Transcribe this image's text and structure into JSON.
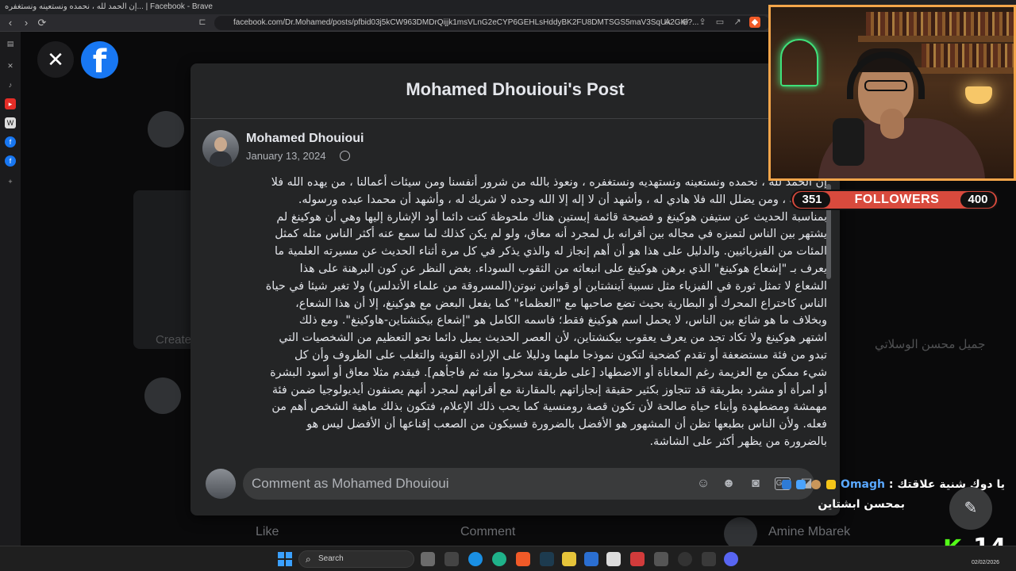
{
  "window": {
    "title": "إن الحمد لله ، نحمده ونستعينه ونستغفره... | Facebook - Brave",
    "url": "facebook.com/Dr.Mohamed/posts/pfbid03j5kCW963DMDrQijjk1msVLnG2eCYP6GEHLsHddyBK2FU8DMTSGS5maV3SqUx2GKl?..."
  },
  "modal": {
    "title": "Mohamed Dhouioui's Post",
    "author": "Mohamed Dhouioui",
    "date": "January 13, 2024",
    "body_lines": [
      "إن الحمد لله ، نحمده ونستعينه ونستهديه ونستغفره ، ونعوذ بالله من شرور أنفسنا ومن سيئات أعمالنا ، من يهده الله فلا",
      "مضل له ، ومن يضلل الله فلا هادي له ، وأشهد أن لا إله إلا الله وحده لا شريك له ، وأشهد أن محمدا عبده ورسوله.",
      "بمناسبة الحديث عن ستيفن هوكينغ و فضيحة قائمة إبستين هناك ملحوظة كنت دائما أود الإشارة إليها وهي أن هوكينغ لم",
      "يشتهر بين الناس لتميزه في مجاله بين أقرانه بل لمجرد أنه معاق، ولو لم يكن كذلك لما سمع عنه أكثر الناس مثله كمثل",
      "المئات من الفيزيائيين. والدليل على هذا هو أن أهم إنجاز له والذي يذكر في كل مرة أثناء الحديث عن مسيرته العلمية ما",
      "يعرف بـ \"إشعاع هوكينغ\" الذي برهن هوكينغ على انبعاثه من الثقوب السوداء. بغض النظر عن كون البرهنة على هذا",
      "الشعاع لا تمثل ثورة في الفيزياء مثل نسبية آينشتاين أو قوانين نيوتن(المسروقة من علماء الأندلس) ولا تغير شيئا في حياة",
      "الناس كاختراع المحرك أو البطارية بحيث تضع صاحبها مع \"العظماء\" كما يفعل البعض مع هوكينغ، إلا أن هذا الشعاع،",
      "وبخلاف ما هو شائع بين الناس، لا يحمل اسم هوكينغ فقط؛ فاسمه الكامل هو \"إشعاع بيكنشتاين-هاوكينغ\". ومع ذلك",
      "اشتهر هوكينغ ولا تكاد تجد من يعرف يعقوب بيكنشتاين، لأن العصر الحديث يميل دائما نحو التعظيم من الشخصيات التي",
      "تبدو من فئة مستضعفة أو تقدم كضحية لتكون نموذجا ملهما ودليلا على الإرادة القوية والتغلب على الظروف وأن كل",
      "شيء ممكن مع العزيمة رغم المعاناة أو الاضطهاد [على طريقة سخروا منه ثم فاجأهم]. فيقدم مثلا معاق أو أسود البشرة",
      "أو امرأة أو مشرد بطريقة قد تتجاوز بكثير حقيقة إنجازاتهم بالمقارنة مع أقرانهم لمجرد أنهم يصنفون أيديولوجيا ضمن فئة",
      "مهمشة ومضطهدة وأبناء حياة صالحة لأن تكون قصة رومنسية كما يحب ذلك الإعلام، فتكون بذلك ماهية الشخص أهم من",
      "فعله. ولأن الناس بطبعها تظن أن المشهور هو الأفضل بالضرورة فسيكون من الصعب إقناعها أن الأفضل ليس هو",
      "بالضرورة من يظهر أكثر على الشاشة."
    ],
    "comment_placeholder": "Comment as Mohamed Dhouioui"
  },
  "background": {
    "create_label": "Create",
    "side_name": "جميل محسن الوسلاتي",
    "like_label": "Like",
    "comment_label": "Comment",
    "bottom_name": "Amine Mbarek"
  },
  "stream": {
    "followers_start": "351",
    "followers_label": "FOLLOWERS",
    "followers_goal": "400",
    "chat_user": "Omagh",
    "chat_message_1": "يا دوك شنية علاقتك",
    "chat_message_2": "بمحسن ابشتاين",
    "kick_logo": "K",
    "viewer_count": "14",
    "date": "02/02/2026"
  },
  "taskbar": {
    "search_label": "Search"
  },
  "colors": {
    "facebook_blue": "#1877f2",
    "modal_bg": "#242526",
    "followers_red": "#d84a3d",
    "webcam_border": "#f3a54a",
    "kick_green": "#53fc18"
  }
}
